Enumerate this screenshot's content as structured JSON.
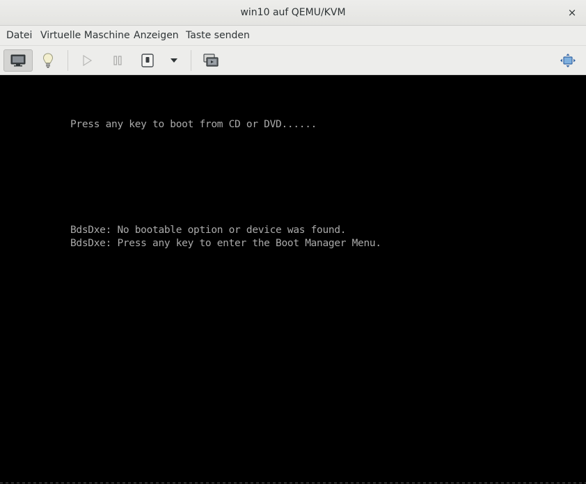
{
  "window": {
    "title": "win10 auf QEMU/KVM",
    "close_glyph": "×"
  },
  "menubar": {
    "items": [
      {
        "label": "Datei"
      },
      {
        "label": "Virtuelle Maschine"
      },
      {
        "label": "Anzeigen"
      },
      {
        "label": "Taste senden"
      }
    ]
  },
  "toolbar": {
    "buttons": [
      {
        "icon": "monitor-icon",
        "state": "active"
      },
      {
        "icon": "lightbulb-icon",
        "state": "normal"
      },
      {
        "icon": "play-icon",
        "state": "disabled"
      },
      {
        "icon": "pause-icon",
        "state": "disabled"
      },
      {
        "icon": "power-icon",
        "state": "normal"
      },
      {
        "icon": "chevron-down-icon",
        "state": "normal"
      },
      {
        "icon": "snapshots-icon",
        "state": "normal"
      },
      {
        "icon": "fullscreen-icon",
        "state": "normal"
      }
    ]
  },
  "console": {
    "lines": [
      "Press any key to boot from CD or DVD......",
      "BdsDxe: No bootable option or device was found.",
      "BdsDxe: Press any key to enter the Boot Manager Menu."
    ],
    "text_color": "#aaaaaa",
    "background": "#000000"
  }
}
